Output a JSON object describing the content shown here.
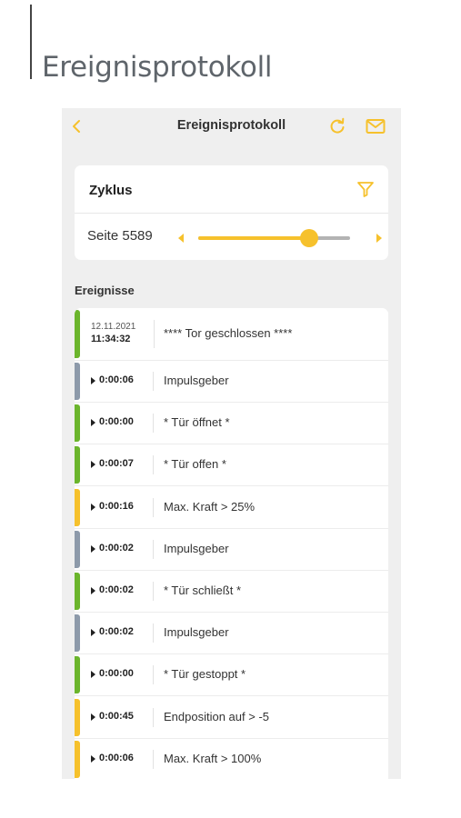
{
  "page": {
    "heading": "Ereignisprotokoll"
  },
  "colors": {
    "accent": "#f6c12c",
    "green": "#6bb52c",
    "gray": "#8d9aaa",
    "yellow": "#f6c12c"
  },
  "navbar": {
    "title": "Ereignisprotokoll",
    "back_icon": "chevron-left-icon",
    "refresh_icon": "refresh-icon",
    "mail_icon": "mail-icon"
  },
  "filter": {
    "cycle_label": "Zyklus",
    "filter_icon": "filter-icon",
    "page_label": "Seite 5589",
    "slider_level": 0.73
  },
  "events_section": {
    "title": "Ereignisse"
  },
  "events_head": {
    "date": "12.11.2021",
    "time": "11:34:32",
    "description": "**** Tor geschlossen ****",
    "status": "green"
  },
  "events": [
    {
      "time": "0:00:06",
      "description": "Impulsgeber",
      "status": "gray"
    },
    {
      "time": "0:00:00",
      "description": "* Tür öffnet *",
      "status": "green"
    },
    {
      "time": "0:00:07",
      "description": "* Tür offen *",
      "status": "green"
    },
    {
      "time": "0:00:16",
      "description": "Max. Kraft > 25%",
      "status": "yellow"
    },
    {
      "time": "0:00:02",
      "description": "Impulsgeber",
      "status": "gray"
    },
    {
      "time": "0:00:02",
      "description": "* Tür schließt *",
      "status": "green"
    },
    {
      "time": "0:00:02",
      "description": "Impulsgeber",
      "status": "gray"
    },
    {
      "time": "0:00:00",
      "description": "* Tür gestoppt *",
      "status": "green"
    },
    {
      "time": "0:00:45",
      "description": "Endposition auf > -5",
      "status": "yellow"
    },
    {
      "time": "0:00:06",
      "description": "Max. Kraft > 100%",
      "status": "yellow"
    }
  ]
}
